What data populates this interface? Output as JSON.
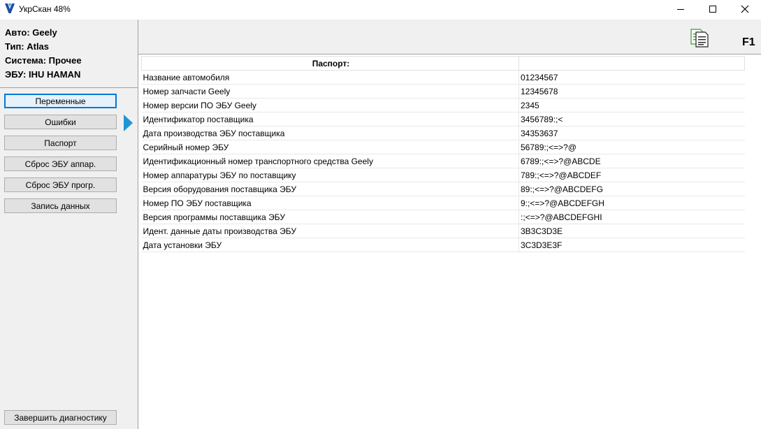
{
  "window": {
    "title": "УкрСкан 48%",
    "icons": {
      "logo": "ukrscan-v-logo",
      "minimize": "minimize-icon",
      "maximize": "maximize-icon",
      "close": "close-icon"
    },
    "colors": {
      "accent": "#0078d7",
      "marker": "#1e96d6",
      "logo": "#1a4fa0"
    }
  },
  "vehicle": {
    "auto": "Авто: Geely",
    "type": "Тип: Atlas",
    "system": "Система: Прочее",
    "ecu": "ЭБУ: IHU HAMAN"
  },
  "sidebar": {
    "buttons": [
      {
        "label": "Переменные",
        "active": true
      },
      {
        "label": "Ошибки",
        "active": false
      },
      {
        "label": "Паспорт",
        "active": false
      },
      {
        "label": "Сброс ЭБУ аппар.",
        "active": false
      },
      {
        "label": "Сброс ЭБУ прогр.",
        "active": false
      },
      {
        "label": "Запись данных",
        "active": false
      }
    ],
    "finish_label": "Завершить диагностику"
  },
  "toolbar": {
    "doc_icon": "document-list-icon",
    "help_key": "F1"
  },
  "passport": {
    "header": "Паспорт:",
    "header_value": "",
    "rows": [
      {
        "name": "Название автомобиля",
        "value": "01234567"
      },
      {
        "name": "Номер запчасти Geely",
        "value": "12345678"
      },
      {
        "name": "Номер версии ПО ЭБУ Geely",
        "value": "2345"
      },
      {
        "name": "Идентификатор поставщика",
        "value": "3456789:;<"
      },
      {
        "name": "Дата производства ЭБУ поставщика",
        "value": "34353637"
      },
      {
        "name": "Серийный номер ЭБУ",
        "value": "56789:;<=>?@"
      },
      {
        "name": "Идентификационный номер транспортного средства Geely",
        "value": "6789:;<=>?@ABCDE"
      },
      {
        "name": "Номер аппаратуры ЭБУ по поставщику",
        "value": "789:;<=>?@ABCDEF"
      },
      {
        "name": "Версия оборудования поставщика ЭБУ",
        "value": "89:;<=>?@ABCDEFG"
      },
      {
        "name": "Номер ПО ЭБУ поставщика",
        "value": "9:;<=>?@ABCDEFGH"
      },
      {
        "name": "Версия программы поставщика ЭБУ",
        "value": ":;<=>?@ABCDEFGHI"
      },
      {
        "name": "Идент. данные даты производства ЭБУ",
        "value": "3B3C3D3E"
      },
      {
        "name": "Дата установки ЭБУ",
        "value": "3C3D3E3F"
      }
    ]
  }
}
